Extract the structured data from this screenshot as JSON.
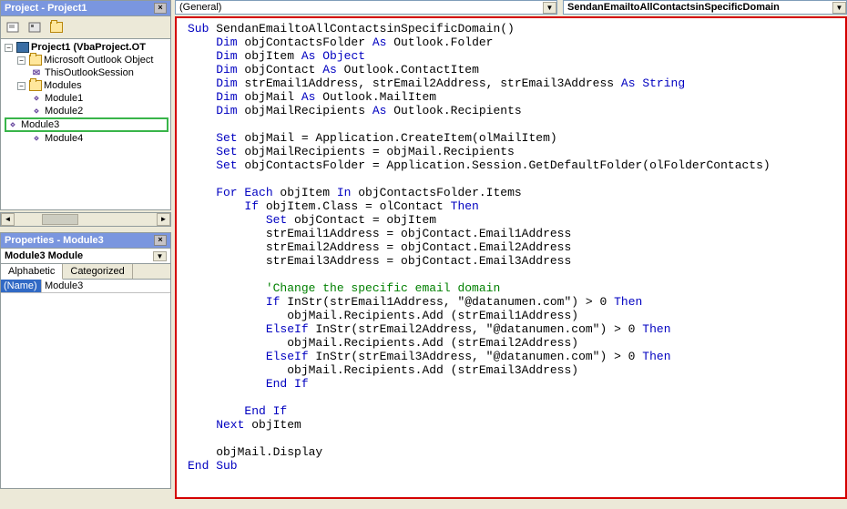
{
  "project_pane": {
    "title": "Project - Project1",
    "tree": {
      "root_label": "Project1 (VbaProject.OT",
      "outlook_label": "Microsoft Outlook Object",
      "session_label": "ThisOutlookSession",
      "modules_label": "Modules",
      "mods": [
        "Module1",
        "Module2",
        "Module3",
        "Module4"
      ],
      "selected": "Module3"
    }
  },
  "properties_pane": {
    "title": "Properties - Module3",
    "object_desc": "Module3 Module",
    "tabs": {
      "alphabetic": "Alphabetic",
      "categorized": "Categorized"
    },
    "row": {
      "name_label": "(Name)",
      "name_value": "Module3"
    }
  },
  "dropdowns": {
    "left": "(General)",
    "right": "SendanEmailtoAllContactsinSpecificDomain"
  },
  "code": {
    "l1a": "Sub",
    "l1b": " SendanEmailtoAllContactsinSpecificDomain()",
    "l2a": "    Dim",
    "l2b": " objContactsFolder ",
    "l2c": "As",
    "l2d": " Outlook.Folder",
    "l3a": "    Dim",
    "l3b": " objItem ",
    "l3c": "As",
    "l3d": " ",
    "l3e": "Object",
    "l4a": "    Dim",
    "l4b": " objContact ",
    "l4c": "As",
    "l4d": " Outlook.ContactItem",
    "l5a": "    Dim",
    "l5b": " strEmail1Address, strEmail2Address, strEmail3Address ",
    "l5c": "As",
    "l5d": " ",
    "l5e": "String",
    "l6a": "    Dim",
    "l6b": " objMail ",
    "l6c": "As",
    "l6d": " Outlook.MailItem",
    "l7a": "    Dim",
    "l7b": " objMailRecipients ",
    "l7c": "As",
    "l7d": " Outlook.Recipients",
    "l9a": "    Set",
    "l9b": " objMail = Application.CreateItem(olMailItem)",
    "l10a": "    Set",
    "l10b": " objMailRecipients = objMail.Recipients",
    "l11a": "    Set",
    "l11b": " objContactsFolder = Application.Session.GetDefaultFolder(olFolderContacts)",
    "l13a": "    For Each",
    "l13b": " objItem ",
    "l13c": "In",
    "l13d": " objContactsFolder.Items",
    "l14a": "        If",
    "l14b": " objItem.Class = olContact ",
    "l14c": "Then",
    "l15a": "           Set",
    "l15b": " objContact = objItem",
    "l16": "           strEmail1Address = objContact.Email1Address",
    "l17": "           strEmail2Address = objContact.Email2Address",
    "l18": "           strEmail3Address = objContact.Email3Address",
    "l20": "           'Change the specific email domain",
    "l21a": "           If",
    "l21b": " InStr(strEmail1Address, \"@datanumen.com\") > 0 ",
    "l21c": "Then",
    "l22": "              objMail.Recipients.Add (strEmail1Address)",
    "l23a": "           ElseIf",
    "l23b": " InStr(strEmail2Address, \"@datanumen.com\") > 0 ",
    "l23c": "Then",
    "l24": "              objMail.Recipients.Add (strEmail2Address)",
    "l25a": "           ElseIf",
    "l25b": " InStr(strEmail3Address, \"@datanumen.com\") > 0 ",
    "l25c": "Then",
    "l26": "              objMail.Recipients.Add (strEmail3Address)",
    "l27": "           End If",
    "l29": "        End If",
    "l30a": "    Next",
    "l30b": " objItem",
    "l32": "    objMail.Display",
    "l33": "End Sub"
  }
}
